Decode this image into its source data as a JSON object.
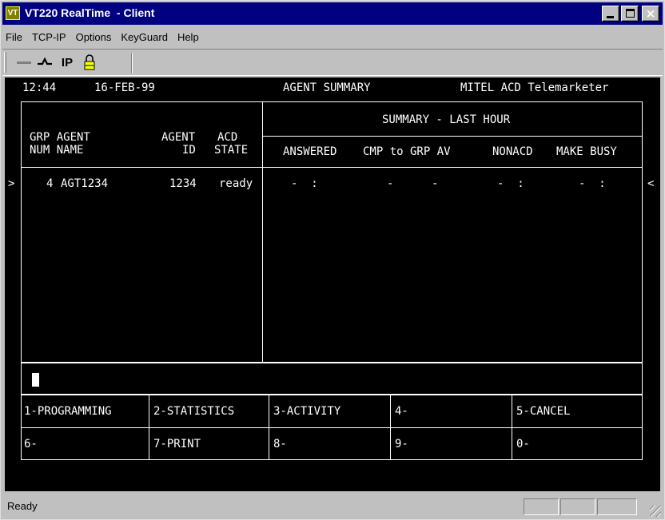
{
  "window": {
    "icon_text": "VT",
    "title": "VT220 RealTime  - Client"
  },
  "menu": [
    "File",
    "TCP-IP",
    "Options",
    "KeyGuard",
    "Help"
  ],
  "toolbar": {
    "ip_label": "IP",
    "connect_glyph": "⌁"
  },
  "terminal": {
    "time": "12:44",
    "date": "16-FEB-99",
    "screen_title": "AGENT SUMMARY",
    "system": "MITEL ACD Telemarketer",
    "summary_header": "SUMMARY - LAST HOUR",
    "col_grp_line1": "GRP AGENT",
    "col_grp_line2": "NUM NAME",
    "col_agent_line1": "AGENT",
    "col_agent_line2": "ID",
    "col_acd_line1": "ACD",
    "col_acd_line2": "STATE",
    "col_answered": "ANSWERED",
    "col_cmp": "CMP to GRP AV",
    "col_nonacd": "NONACD",
    "col_make_busy": "MAKE BUSY",
    "left_marker": ">",
    "right_marker": "<",
    "rows": [
      {
        "grp_num": "4",
        "agent_name": "AGT1234",
        "agent_id": "1234",
        "acd_state": "ready",
        "answered": "-  :",
        "cmp_to_grp": "-",
        "avg": "-",
        "nonacd": "-  :",
        "make_busy": "-  :"
      }
    ],
    "function_keys": [
      "1-PROGRAMMING",
      "2-STATISTICS",
      "3-ACTIVITY",
      "4-",
      "5-CANCEL",
      "6-",
      "7-PRINT",
      "8-",
      "9-",
      "0-"
    ]
  },
  "status": {
    "text": "Ready"
  },
  "colors": {
    "title_bar": "#000080",
    "terminal_bg": "#000000",
    "terminal_fg": "#ffffff",
    "chrome": "#c0c0c0"
  }
}
